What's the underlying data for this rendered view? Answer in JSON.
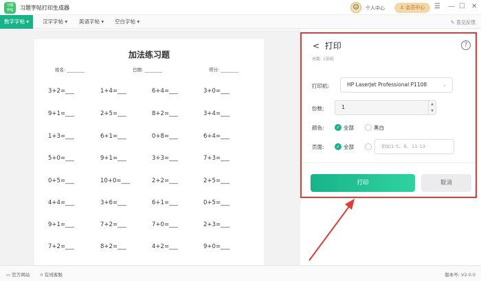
{
  "app": {
    "logo_text": "习题字帖",
    "title": "习题字帖打印生成器",
    "user_center": "个人中心",
    "vip_center": "会员中心",
    "feedback": "意见反馈"
  },
  "tabs": [
    {
      "label": "数字字帖"
    },
    {
      "label": "汉字字帖"
    },
    {
      "label": "英语字帖"
    },
    {
      "label": "空白字帖"
    }
  ],
  "worksheet": {
    "title": "加法练习题",
    "name_label": "姓名:",
    "date_label": "日期:",
    "score_label": "得分:",
    "problems": [
      [
        "3+2=",
        "1+4=",
        "6+4=",
        "3+0="
      ],
      [
        "9+1=",
        "2+5=",
        "8+2=",
        "3+4="
      ],
      [
        "1+3=",
        "6+1=",
        "0+8=",
        "6+4="
      ],
      [
        "5+0=",
        "9+1=",
        "3+3=",
        "7+3="
      ],
      [
        "0+5=",
        "10+0=",
        "2+2=",
        "2+5="
      ],
      [
        "4+4=",
        "3+6=",
        "6+1=",
        "0+5="
      ],
      [
        "9+1=",
        "7+2=",
        "7+0=",
        "2+3="
      ],
      [
        "7+2=",
        "8+2=",
        "4+2=",
        "9+0="
      ]
    ]
  },
  "print_panel": {
    "back": "<",
    "title": "打印",
    "help": "?",
    "total": "总数: 1张纸",
    "printer_label": "打印机:",
    "printer_value": "HP LaserJet Professional P1108",
    "copies_label": "份数:",
    "copies_value": "1",
    "color_label": "颜色:",
    "color_all": "全部",
    "color_bw": "黑白",
    "pages_label": "页面:",
    "pages_all": "全部",
    "pages_placeholder": "例如1-5、8、11-13",
    "print_button": "打印",
    "cancel_button": "取消"
  },
  "status": {
    "website": "官方网站",
    "support": "在线客服",
    "version": "版本号: V2.0.0"
  },
  "colors": {
    "accent": "#19b38a",
    "highlight": "#e53935"
  }
}
